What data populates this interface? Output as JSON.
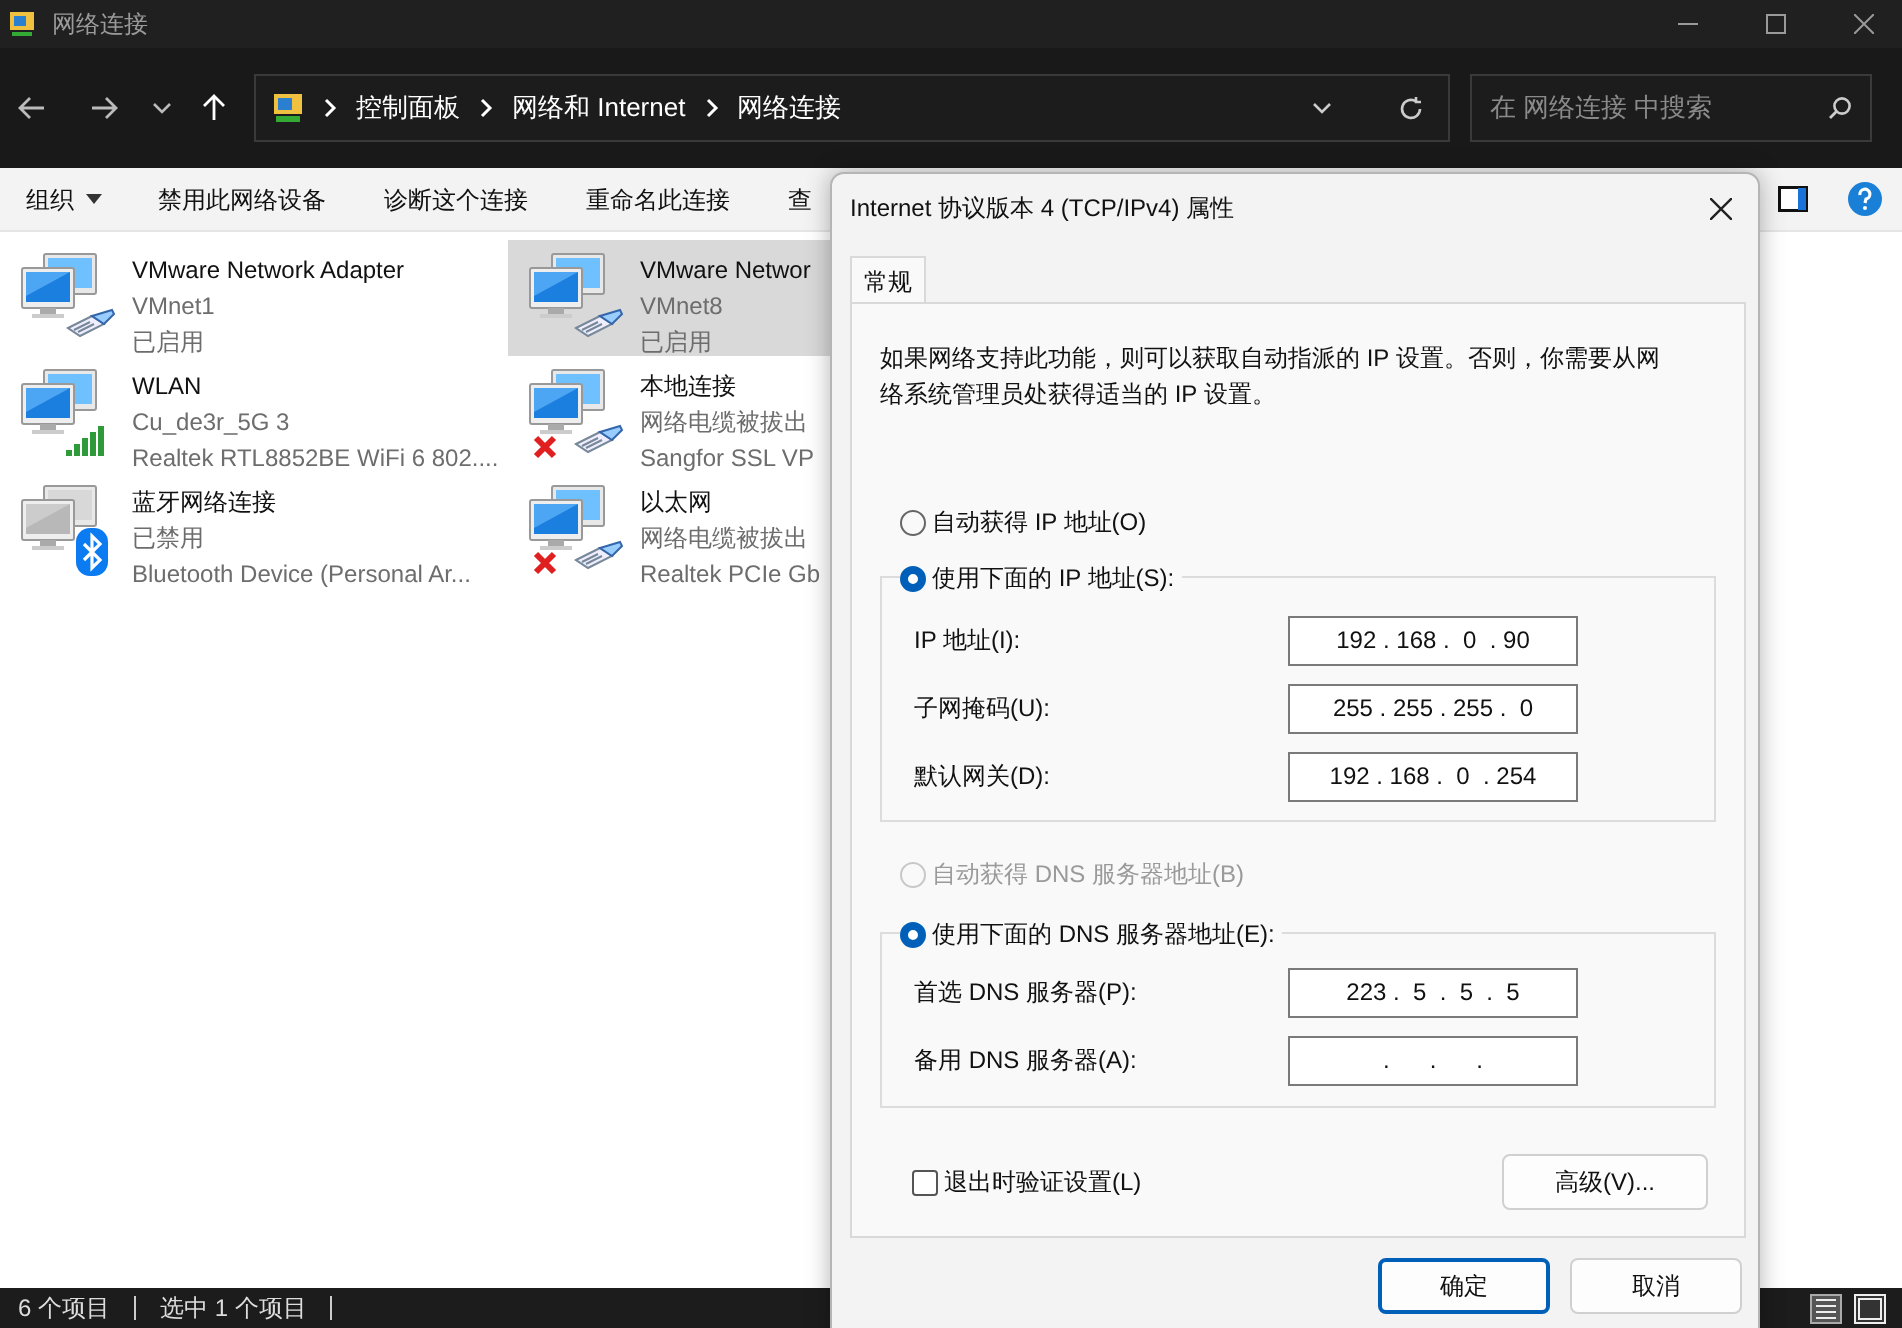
{
  "window": {
    "title": "网络连接"
  },
  "address_bar": {
    "breadcrumbs": [
      "控制面板",
      "网络和 Internet",
      "网络连接"
    ]
  },
  "search": {
    "placeholder": "在 网络连接 中搜索"
  },
  "toolbar": {
    "items": [
      "组织",
      "禁用此网络设备",
      "诊断这个连接",
      "重命名此连接",
      "查"
    ]
  },
  "connections": [
    {
      "name": "VMware Network Adapter",
      "line2": "VMnet1",
      "line3": "已启用",
      "kind": "cable",
      "disconnected": false,
      "disabled": false,
      "selected": false
    },
    {
      "name": "VMware Networ",
      "line2": "VMnet8",
      "line3": "已启用",
      "kind": "cable",
      "disconnected": false,
      "disabled": false,
      "selected": true
    },
    {
      "name": "WLAN",
      "line2": "Cu_de3r_5G 3",
      "line3": "Realtek RTL8852BE WiFi 6 802....",
      "kind": "wifi",
      "disconnected": false,
      "disabled": false,
      "selected": false
    },
    {
      "name": "本地连接",
      "line2": "网络电缆被拔出",
      "line3": "Sangfor SSL VP",
      "kind": "cable",
      "disconnected": true,
      "disabled": false,
      "selected": false
    },
    {
      "name": "蓝牙网络连接",
      "line2": "已禁用",
      "line3": "Bluetooth Device (Personal Ar...",
      "kind": "bluetooth",
      "disconnected": false,
      "disabled": true,
      "selected": false
    },
    {
      "name": "以太网",
      "line2": "网络电缆被拔出",
      "line3": "Realtek PCIe Gb",
      "kind": "cable",
      "disconnected": true,
      "disabled": false,
      "selected": false
    }
  ],
  "status_bar": {
    "count": "6 个项目",
    "selection": "选中 1 个项目"
  },
  "dialog": {
    "title": "Internet 协议版本 4 (TCP/IPv4) 属性",
    "tabs": [
      {
        "label": "常规",
        "selected": true
      }
    ],
    "description": "如果网络支持此功能，则可以获取自动指派的 IP 设置。否则，你需要从网络系统管理员处获得适当的 IP 设置。",
    "ip_auto": {
      "label": "自动获得 IP 地址(O)",
      "selected": false,
      "disabled": false
    },
    "ip_manual": {
      "label": "使用下面的 IP 地址(S):",
      "selected": true,
      "disabled": false
    },
    "ip_fields": [
      {
        "label": "IP 地址(I):",
        "value": "192 . 168 .  0  . 90"
      },
      {
        "label": "子网掩码(U):",
        "value": "255 . 255 . 255 .  0"
      },
      {
        "label": "默认网关(D):",
        "value": "192 . 168 .  0  . 254"
      }
    ],
    "dns_auto": {
      "label": "自动获得 DNS 服务器地址(B)",
      "selected": false,
      "disabled": true
    },
    "dns_manual": {
      "label": "使用下面的 DNS 服务器地址(E):",
      "selected": true,
      "disabled": false
    },
    "dns_fields": [
      {
        "label": "首选 DNS 服务器(P):",
        "value": "223 .  5  .  5  .  5"
      },
      {
        "label": "备用 DNS 服务器(A):",
        "value": ".      .      ."
      }
    ],
    "validate": {
      "label": "退出时验证设置(L)",
      "checked": false
    },
    "advanced_button": "高级(V)...",
    "buttons": [
      "确定",
      "取消"
    ]
  }
}
